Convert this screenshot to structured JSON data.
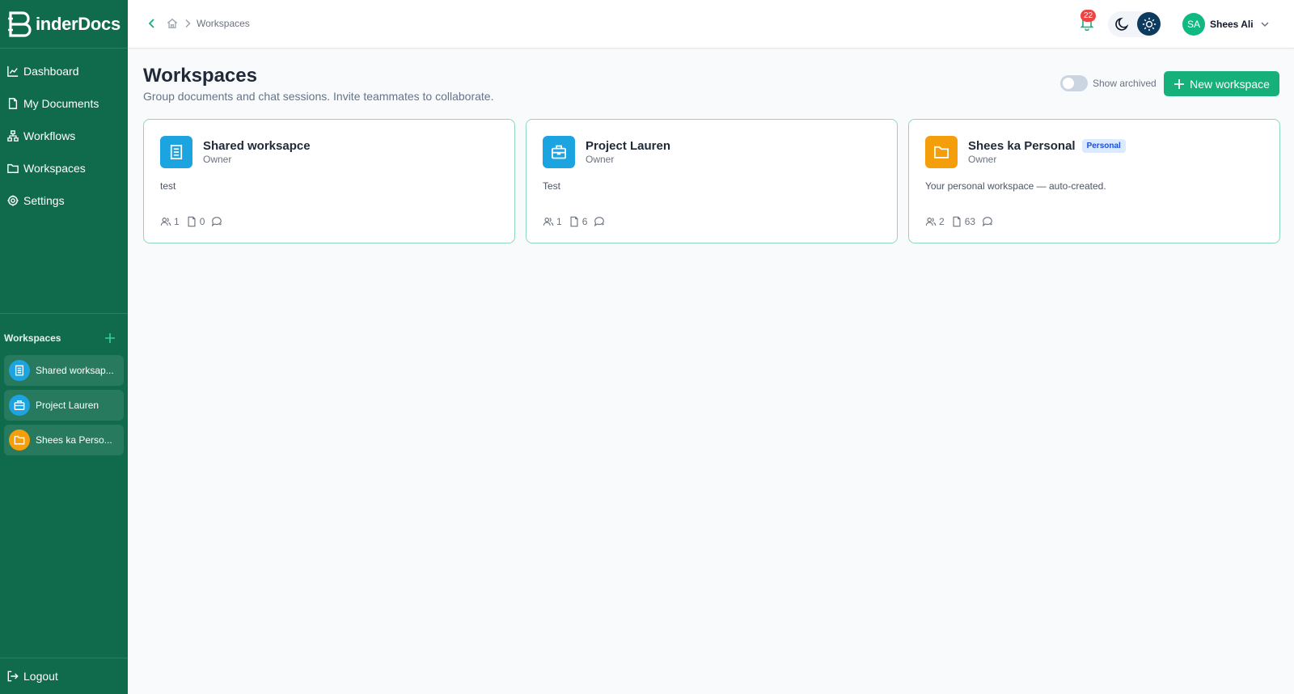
{
  "app": {
    "brand": "inderDocs"
  },
  "sidebar": {
    "nav": [
      {
        "label": "Dashboard",
        "icon": "chart-icon"
      },
      {
        "label": "My Documents",
        "icon": "document-icon"
      },
      {
        "label": "Workflows",
        "icon": "workflow-icon"
      },
      {
        "label": "Workspaces",
        "icon": "folder-icon"
      },
      {
        "label": "Settings",
        "icon": "gear-icon"
      }
    ],
    "workspaces_heading": "Workspaces",
    "workspaces": [
      {
        "label": "Shared worksap...",
        "color": "#1ba4e0",
        "icon": "document-icon"
      },
      {
        "label": "Project Lauren",
        "color": "#1ba4e0",
        "icon": "briefcase-icon"
      },
      {
        "label": "Shees ka Perso...",
        "color": "#f59e0b",
        "icon": "folder-icon"
      }
    ],
    "logout_label": "Logout"
  },
  "header": {
    "breadcrumb_current": "Workspaces",
    "notification_count": "22",
    "user_initials": "SA",
    "user_name": "Shees Ali"
  },
  "main": {
    "title": "Workspaces",
    "subtitle": "Group documents and chat sessions. Invite teammates to collaborate.",
    "show_archived_label": "Show archived",
    "new_button_label": "New workspace",
    "cards": [
      {
        "title": "Shared worksapce",
        "role": "Owner",
        "description": "test",
        "members": "1",
        "documents": "0",
        "badge": "",
        "color": "#1ba4e0",
        "icon": "document-icon"
      },
      {
        "title": "Project Lauren",
        "role": "Owner",
        "description": "Test",
        "members": "1",
        "documents": "6",
        "badge": "",
        "color": "#1ba4e0",
        "icon": "briefcase-icon"
      },
      {
        "title": "Shees ka Personal",
        "role": "Owner",
        "description": "Your personal workspace — auto-created.",
        "members": "2",
        "documents": "63",
        "badge": "Personal",
        "color": "#f59e0b",
        "icon": "folder-icon"
      }
    ]
  },
  "colors": {
    "sidebar": "#0f6b4c",
    "accent": "#16b07a",
    "card_border": "#8fd6bf"
  }
}
